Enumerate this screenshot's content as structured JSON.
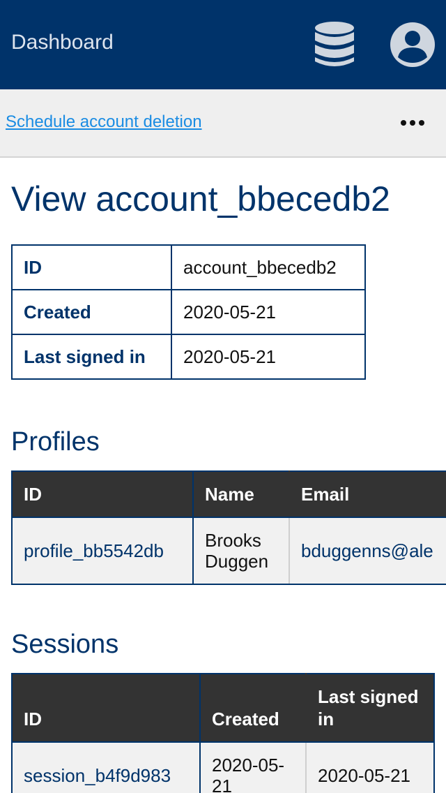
{
  "header": {
    "title": "Dashboard",
    "icons": [
      "database-icon",
      "user-account-icon"
    ]
  },
  "actions": {
    "schedule_deletion": "Schedule account deletion",
    "more": "more-options-icon"
  },
  "page": {
    "title": "View account_bbecedb2"
  },
  "account": {
    "rows": [
      {
        "label": "ID",
        "value": "account_bbecedb2"
      },
      {
        "label": "Created",
        "value": "2020-05-21"
      },
      {
        "label": "Last signed in",
        "value": "2020-05-21"
      }
    ]
  },
  "profiles": {
    "title": "Profiles",
    "columns": [
      "ID",
      "Name",
      "Email"
    ],
    "rows": [
      {
        "id": "profile_bb5542db",
        "name": "Brooks Duggen",
        "email": "bduggenns@ale"
      }
    ]
  },
  "sessions": {
    "title": "Sessions",
    "columns": [
      "ID",
      "Created",
      "Last signed in"
    ],
    "rows": [
      {
        "id": "session_b4f9d983",
        "created": "2020-05-21",
        "last_signed_in": "2020-05-21"
      }
    ]
  },
  "colors": {
    "brand": "#00336a",
    "link": "#1a8ce3",
    "table_header": "#333333"
  }
}
